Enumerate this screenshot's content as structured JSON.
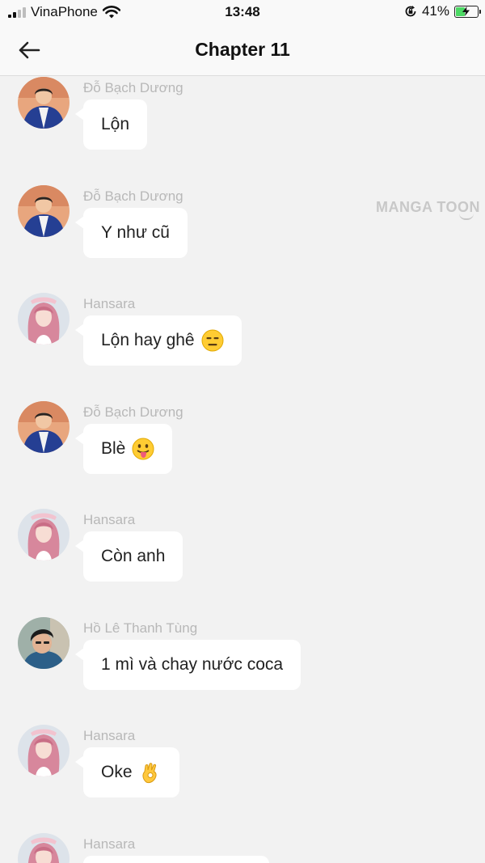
{
  "status": {
    "carrier": "VinaPhone",
    "time": "13:48",
    "battery": "41%",
    "battery_level": 0.41,
    "signal_bars": 2,
    "icons": [
      "signal-icon",
      "wifi-icon",
      "rotation-lock-icon",
      "battery-charging-icon"
    ]
  },
  "header": {
    "title": "Chapter 11",
    "back_icon": "arrow-left-icon"
  },
  "watermark": {
    "text": "MANGA TOON"
  },
  "colors": {
    "background": "#f2f2f2",
    "bubble": "#ffffff",
    "sender_name": "#b8b8b8",
    "battery_green": "#4cd964"
  },
  "messages": [
    {
      "sender": "Đỗ Bạch Dương",
      "text": "Lộn",
      "emoji": "",
      "avatar": "boy-blue-jacket-avatar"
    },
    {
      "sender": "Đỗ Bạch Dương",
      "text": "Y như cũ",
      "emoji": "",
      "avatar": "boy-blue-jacket-avatar"
    },
    {
      "sender": "Hansara",
      "text": "Lộn hay ghê",
      "emoji": "expressionless-face-emoji",
      "avatar": "pink-hair-girl-avatar"
    },
    {
      "sender": "Đỗ Bạch Dương",
      "text": "Blè",
      "emoji": "tongue-out-face-emoji",
      "avatar": "boy-blue-jacket-avatar"
    },
    {
      "sender": "Hansara",
      "text": "Còn anh",
      "emoji": "",
      "avatar": "pink-hair-girl-avatar"
    },
    {
      "sender": "Hồ Lê Thanh Tùng",
      "text": "1 mì và chay nước coca",
      "emoji": "",
      "avatar": "boy-black-hair-avatar"
    },
    {
      "sender": "Hansara",
      "text": "Oke",
      "emoji": "ok-hand-emoji",
      "avatar": "pink-hair-girl-avatar"
    },
    {
      "sender": "Hansara",
      "text": "",
      "emoji": "",
      "avatar": "pink-hair-girl-avatar"
    }
  ]
}
